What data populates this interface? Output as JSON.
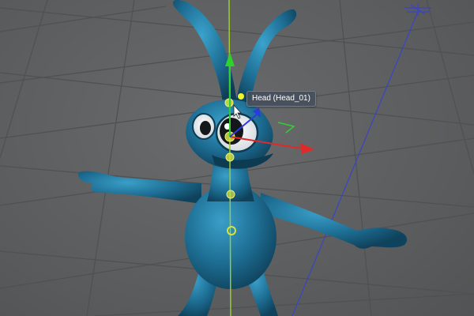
{
  "viewport": {
    "background": "#5f6061",
    "grid_color": "#505152",
    "character_color": "#1e6f95"
  },
  "skeleton": {
    "joint_color": "#d8e23a",
    "bone_color": "#9acd32"
  },
  "gizmo": {
    "x_axis_color": "#e02a2a",
    "y_axis_color": "#2ed12e",
    "z_axis_color": "#2a3be0",
    "axis_icon": "move-gizmo-icon"
  },
  "tooltip": {
    "label": "Head (Head_01)"
  },
  "cursor": {
    "icon": "arrow-cursor-icon"
  }
}
